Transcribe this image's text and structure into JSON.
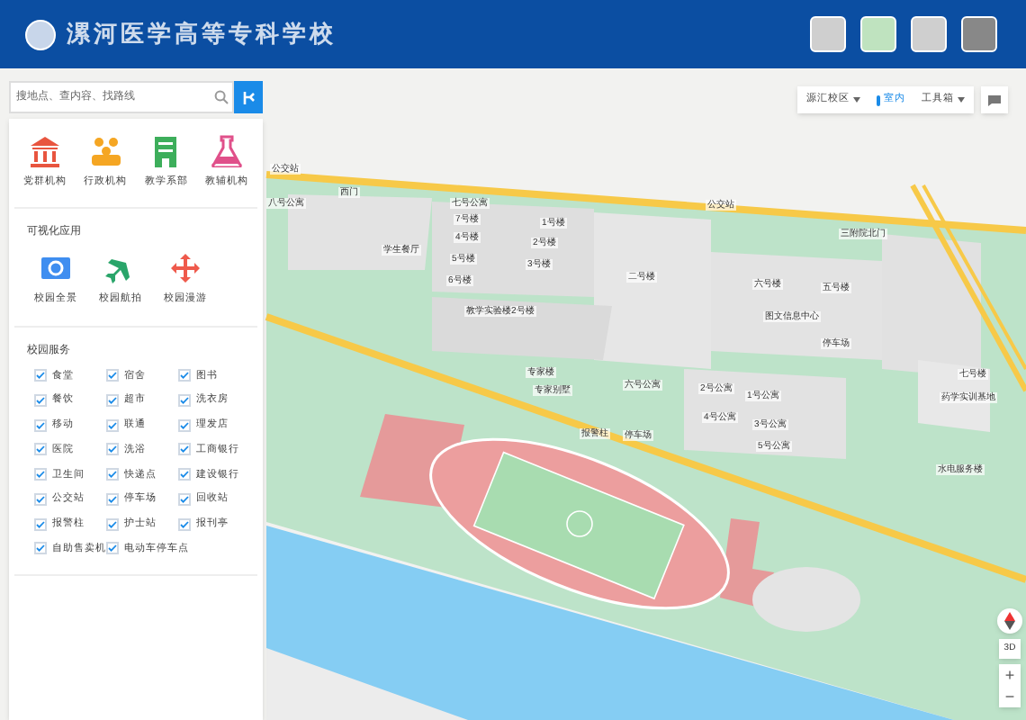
{
  "header": {
    "title": "漯河医学高等专科学校"
  },
  "search": {
    "placeholder": "搜地点、查内容、找路线"
  },
  "toolbar": {
    "campus": "源汇校区",
    "indoor": "室内",
    "toolbox": "工具箱"
  },
  "categories": [
    {
      "label": "党群机构",
      "kind": "bank"
    },
    {
      "label": "行政机构",
      "kind": "people"
    },
    {
      "label": "教学系部",
      "kind": "building"
    },
    {
      "label": "教辅机构",
      "kind": "flask"
    }
  ],
  "visual": {
    "title": "可视化应用",
    "items": [
      {
        "label": "校园全景",
        "kind": "panorama"
      },
      {
        "label": "校园航拍",
        "kind": "plane"
      },
      {
        "label": "校园漫游",
        "kind": "move"
      }
    ]
  },
  "services": {
    "title": "校园服务",
    "items": [
      {
        "label": "食堂",
        "checked": true
      },
      {
        "label": "宿舍",
        "checked": true
      },
      {
        "label": "图书",
        "checked": true
      },
      {
        "label": "餐饮",
        "checked": true
      },
      {
        "label": "超市",
        "checked": true
      },
      {
        "label": "洗衣房",
        "checked": true
      },
      {
        "label": "移动",
        "checked": true
      },
      {
        "label": "联通",
        "checked": true
      },
      {
        "label": "理发店",
        "checked": true
      },
      {
        "label": "医院",
        "checked": true
      },
      {
        "label": "洗浴",
        "checked": true
      },
      {
        "label": "工商银行",
        "checked": true
      },
      {
        "label": "卫生间",
        "checked": true
      },
      {
        "label": "快递点",
        "checked": true
      },
      {
        "label": "建设银行",
        "checked": true
      },
      {
        "label": "公交站",
        "checked": true
      },
      {
        "label": "停车场",
        "checked": true
      },
      {
        "label": "回收站",
        "checked": true
      },
      {
        "label": "报警柱",
        "checked": true
      },
      {
        "label": "护士站",
        "checked": true
      },
      {
        "label": "报刊亭",
        "checked": true
      },
      {
        "label": "自助售卖机",
        "checked": true
      },
      {
        "label": "电动车停车点",
        "checked": true
      }
    ]
  },
  "map_labels": [
    "公交站",
    "八号公寓",
    "西门",
    "七号公寓",
    "7号楼",
    "1号楼",
    "4号楼",
    "2号楼",
    "5号楼",
    "3号楼",
    "6号楼",
    "学生餐厅",
    "公交站",
    "三附院北门",
    "二号楼",
    "六号楼",
    "五号楼",
    "教学实验楼2号楼",
    "图文信息中心",
    "停车场",
    "专家楼",
    "专家别墅",
    "六号公寓",
    "2号公寓",
    "1号公寓",
    "4号公寓",
    "3号公寓",
    "5号公寓",
    "七号楼",
    "药学实训基地",
    "报警柱",
    "停车场",
    "水电服务楼"
  ],
  "map_controls": {
    "three_d": "3D",
    "zoom_in": "+",
    "zoom_out": "−"
  }
}
